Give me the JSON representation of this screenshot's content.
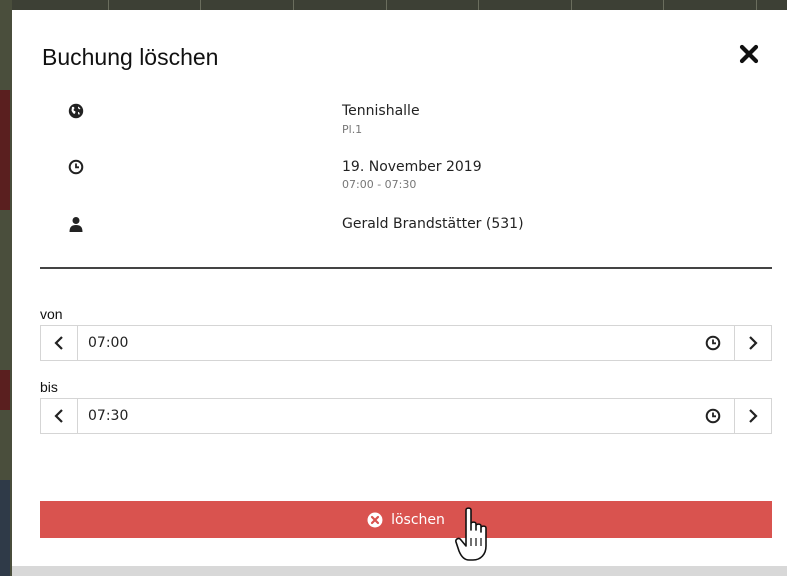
{
  "dialog": {
    "title": "Buchung löschen",
    "location": {
      "name": "Tennishalle",
      "court": "Pl.1",
      "icon": "globe-icon"
    },
    "datetime": {
      "date": "19. November 2019",
      "range": "07:00 - 07:30",
      "icon": "clock-icon"
    },
    "person": {
      "name": "Gerald Brandstätter (531)",
      "icon": "user-icon"
    }
  },
  "from": {
    "label": "von",
    "value": "07:00"
  },
  "to": {
    "label": "bis",
    "value": "07:30"
  },
  "delete_button": {
    "label": "löschen",
    "icon": "times-circle-icon",
    "color": "#d9534f"
  }
}
